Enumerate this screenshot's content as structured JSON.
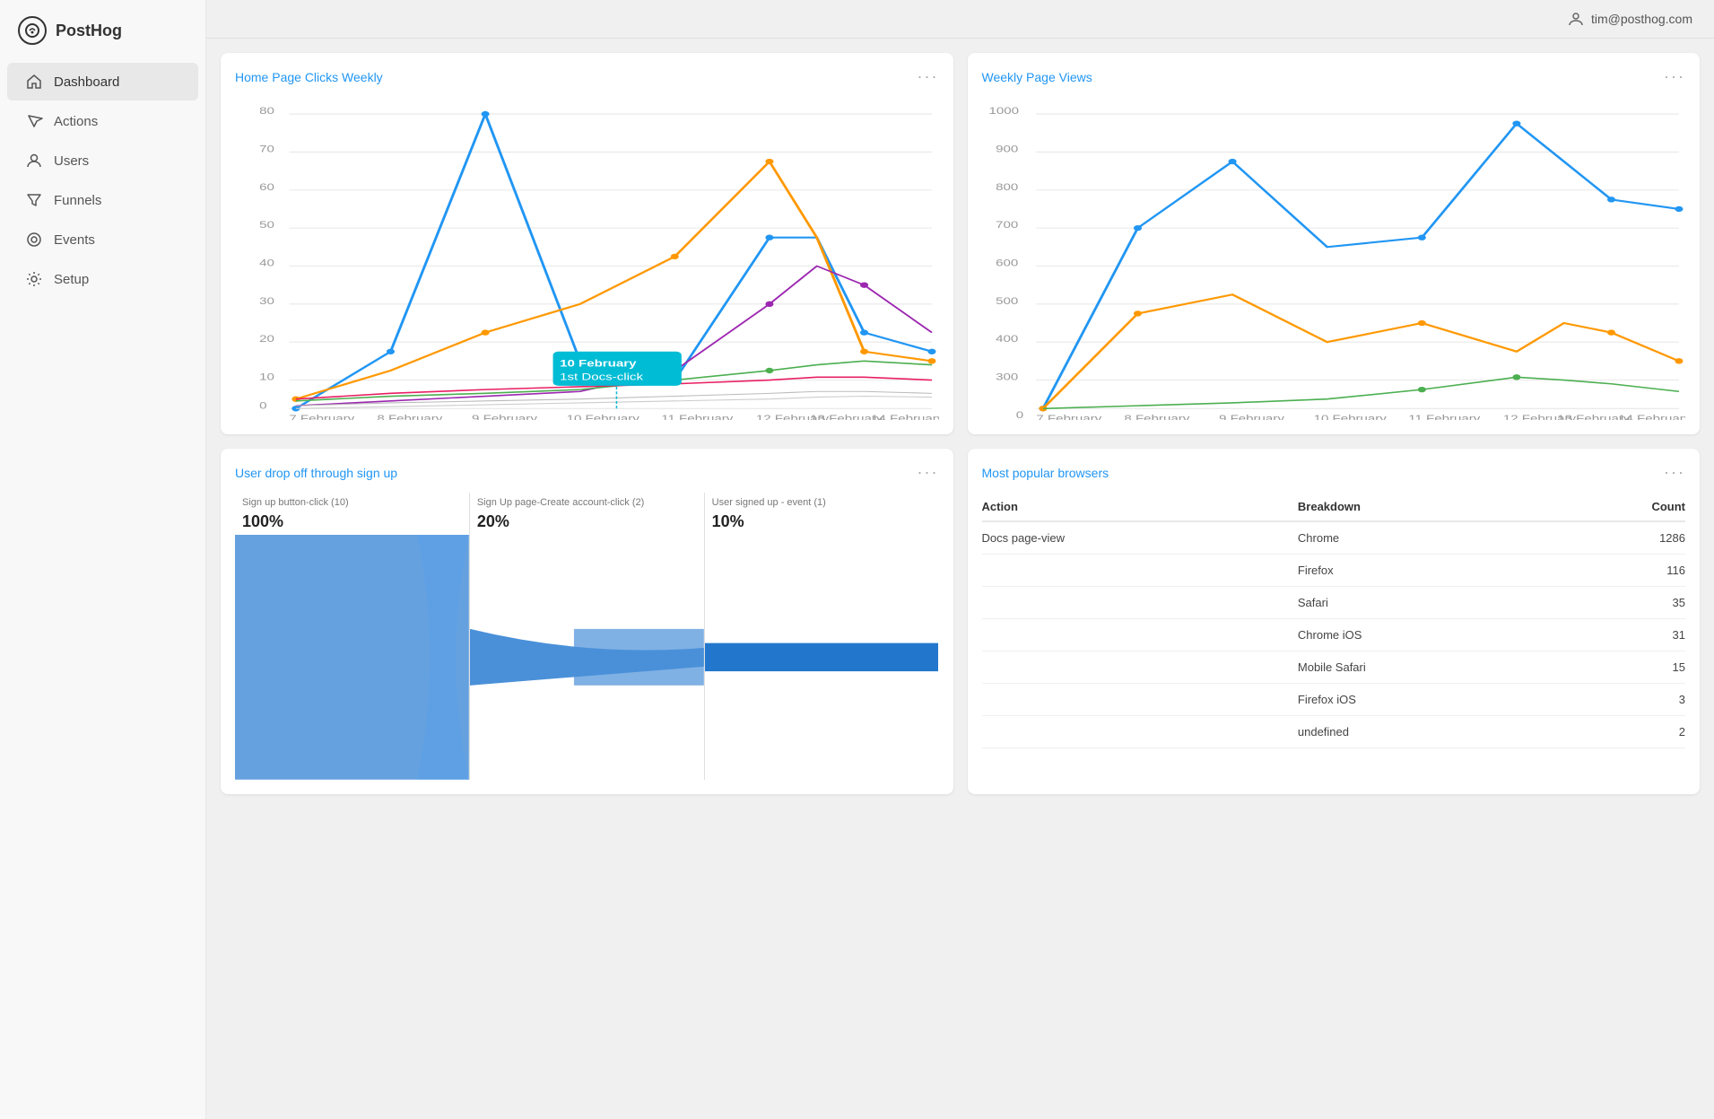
{
  "app": {
    "name": "PostHog",
    "user": "tim@posthog.com"
  },
  "sidebar": {
    "items": [
      {
        "id": "dashboard",
        "label": "Dashboard",
        "active": true
      },
      {
        "id": "actions",
        "label": "Actions",
        "active": false
      },
      {
        "id": "users",
        "label": "Users",
        "active": false
      },
      {
        "id": "funnels",
        "label": "Funnels",
        "active": false
      },
      {
        "id": "events",
        "label": "Events",
        "active": false
      },
      {
        "id": "setup",
        "label": "Setup",
        "active": false
      }
    ]
  },
  "cards": {
    "home_page_clicks": {
      "title": "Home Page Clicks Weekly",
      "tooltip": {
        "date": "10 February",
        "label": "1st Docs-click"
      }
    },
    "weekly_page_views": {
      "title": "Weekly Page Views"
    },
    "user_dropoff": {
      "title": "User drop off through sign up",
      "steps": [
        {
          "label": "Sign up button-click (10)",
          "pct": "100%"
        },
        {
          "label": "Sign Up page-Create account-click (2)",
          "pct": "20%"
        },
        {
          "label": "User signed up - event (1)",
          "pct": "10%"
        }
      ]
    },
    "popular_browsers": {
      "title": "Most popular browsers",
      "columns": [
        "Action",
        "Breakdown",
        "Count"
      ],
      "rows": [
        {
          "action": "Docs page-view",
          "breakdown": "Chrome",
          "count": "1286"
        },
        {
          "action": "",
          "breakdown": "Firefox",
          "count": "116"
        },
        {
          "action": "",
          "breakdown": "Safari",
          "count": "35"
        },
        {
          "action": "",
          "breakdown": "Chrome iOS",
          "count": "31"
        },
        {
          "action": "",
          "breakdown": "Mobile Safari",
          "count": "15"
        },
        {
          "action": "",
          "breakdown": "Firefox iOS",
          "count": "3"
        },
        {
          "action": "",
          "breakdown": "undefined",
          "count": "2"
        }
      ]
    }
  },
  "colors": {
    "brand_blue": "#2196f3",
    "accent_teal": "#00bcd4",
    "orange": "#ff9800",
    "purple": "#9c27b0",
    "green": "#4caf50",
    "pink": "#e91e63",
    "gray": "#9e9e9e"
  }
}
